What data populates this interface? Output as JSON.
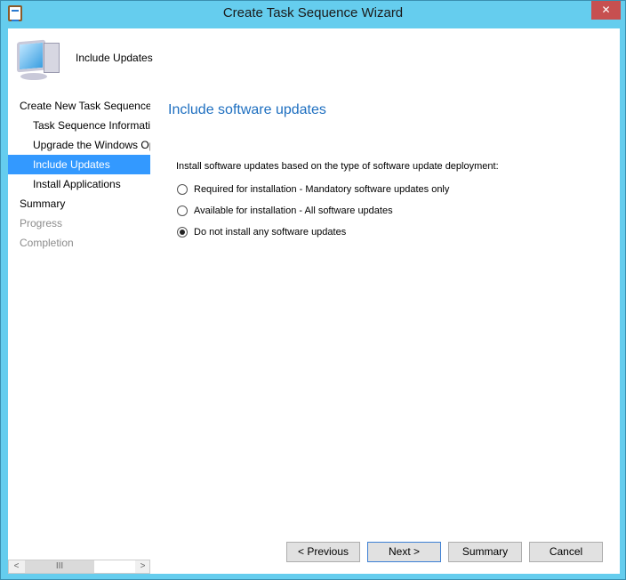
{
  "window": {
    "title": "Create Task Sequence Wizard",
    "close": "✕"
  },
  "header": {
    "title": "Include Updates"
  },
  "nav": [
    {
      "label": "Create New Task Sequence",
      "level": 0,
      "state": "normal"
    },
    {
      "label": "Task Sequence Information",
      "level": 1,
      "state": "normal"
    },
    {
      "label": "Upgrade the Windows Operating System",
      "level": 1,
      "state": "normal"
    },
    {
      "label": "Include Updates",
      "level": 1,
      "state": "selected"
    },
    {
      "label": "Install Applications",
      "level": 1,
      "state": "normal"
    },
    {
      "label": "Summary",
      "level": 0,
      "state": "normal"
    },
    {
      "label": "Progress",
      "level": 0,
      "state": "disabled"
    },
    {
      "label": "Completion",
      "level": 0,
      "state": "disabled"
    }
  ],
  "main": {
    "heading": "Include software updates",
    "instruction": "Install software updates based on the type of software update deployment:",
    "options": [
      {
        "label": "Required for installation - Mandatory software updates only",
        "checked": false
      },
      {
        "label": "Available for installation - All software updates",
        "checked": false
      },
      {
        "label": "Do not install any software updates",
        "checked": true
      }
    ]
  },
  "scrollbar": {
    "left": "<",
    "thumb": "III",
    "right": ">"
  },
  "buttons": {
    "previous": "< Previous",
    "next": "Next >",
    "summary": "Summary",
    "cancel": "Cancel"
  },
  "colors": {
    "frame": "#65cdee",
    "accent": "#3399ff",
    "heading": "#1e6fc0",
    "close": "#c75050"
  }
}
